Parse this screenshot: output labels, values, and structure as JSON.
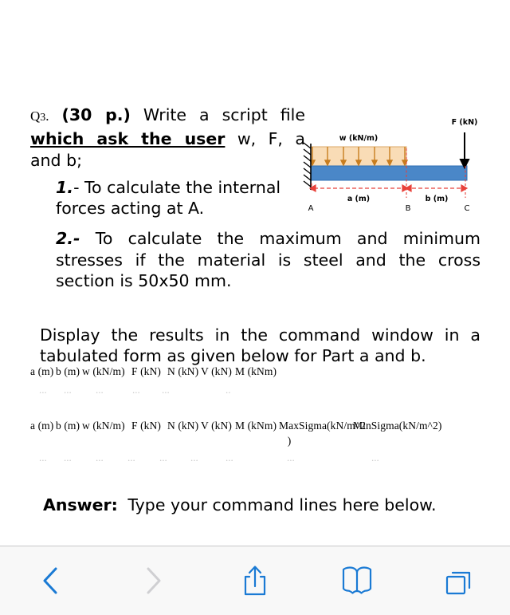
{
  "document": {
    "question_prefix": "Q3.",
    "question_points": "(30 p.)",
    "question_line1_rest": "Write a script file",
    "question_underlined": "which ask the user",
    "question_line2_rest": "w, F, a",
    "question_line3": "and b;",
    "item1_num": "1.",
    "item1_text": "- To calculate the internal forces acting at A.",
    "item2_num": "2.-",
    "item2_line1": "To calculate the maximum and minimum",
    "item2_line2": "stresses if the material is steel and the cross",
    "item2_line3": "section is 50x50 mm.",
    "display_line1": "Display the results in the command window in a",
    "display_line2": "tabulated form as given below for Part a and b.",
    "answer_label": "Answer:",
    "answer_text": "Type your command lines here below."
  },
  "figure": {
    "name": "cantilever-beam-diagram",
    "label_w": "w (kN/m)",
    "label_F": "F (kN)",
    "label_a": "a (m)",
    "label_b": "b (m)",
    "point_A": "A",
    "point_B": "B",
    "point_C": "C",
    "colors": {
      "beam": "#4a87c8",
      "beam_stroke": "#2f6fb5",
      "load_fill": "#f9dcb6",
      "load_stroke": "#d9a25a",
      "load_arrow": "#c87d1e",
      "dimension": "#e8413a",
      "force_arrow": "#000000",
      "support": "#000000"
    }
  },
  "table1": {
    "headers": [
      "a (m)",
      "b (m)",
      "w (kN/m)",
      "F (kN)",
      "N (kN)",
      "V (kN)",
      "M (kNm)"
    ],
    "header_offsets": [
      0,
      32,
      65,
      127,
      172,
      214,
      257
    ],
    "dots": [
      "...",
      "...",
      "...",
      "...",
      "...",
      ".."
    ],
    "dots_offsets": [
      11,
      42,
      82,
      128,
      165,
      245
    ]
  },
  "table2": {
    "headers": [
      "a (m)",
      "b (m)",
      "w (kN/m)",
      "F (kN)",
      "N (kN)",
      "V (kN)",
      "M (kNm)",
      "MaxSigma(kN/m^2",
      "MinSigma(kN/m^2)"
    ],
    "header_offsets": [
      0,
      32,
      65,
      127,
      172,
      214,
      257,
      312,
      405
    ],
    "paren_continuation": ")",
    "dots": [
      "...",
      "...",
      "...",
      "...",
      "...",
      "...",
      "...",
      "...",
      "..."
    ],
    "dots_offsets": [
      11,
      42,
      82,
      122,
      162,
      201,
      245,
      322,
      428
    ]
  },
  "toolbar": {
    "back_label": "back-chevron",
    "forward_label": "forward-chevron",
    "share_label": "share",
    "bookmarks_label": "bookmarks",
    "tabs_label": "tabs",
    "colors": {
      "active": "#1a7ad4",
      "disabled": "#cfcfd2",
      "background": "#f8f8f8",
      "border": "#c7c7c9"
    }
  }
}
